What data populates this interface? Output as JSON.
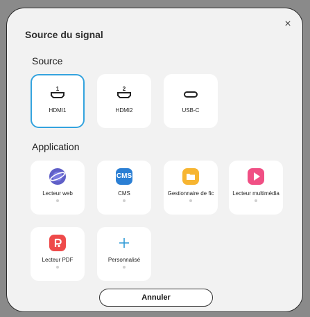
{
  "dialog": {
    "title": "Source du signal",
    "close_glyph": "×",
    "cancel_label": "Annuler"
  },
  "source": {
    "heading": "Source",
    "items": [
      {
        "label": "HDMI1",
        "port": "1",
        "icon": "hdmi-icon",
        "selected": true
      },
      {
        "label": "HDMI2",
        "port": "2",
        "icon": "hdmi-icon",
        "selected": false
      },
      {
        "label": "USB-C",
        "port": "",
        "icon": "usb-c-icon",
        "selected": false
      }
    ],
    "accent": "#33a3de"
  },
  "application": {
    "heading": "Application",
    "items": [
      {
        "label": "Lecteur web",
        "icon": "web-browser-icon",
        "color": "#5f5fc7"
      },
      {
        "label": "CMS",
        "icon": "cms-icon",
        "icon_text": "CMS",
        "color": "#2b7fd4"
      },
      {
        "label": "Gestionnaire de fic",
        "icon": "folder-icon",
        "color": "#f7b531"
      },
      {
        "label": "Lecteur multimédia",
        "icon": "media-player-icon",
        "color": "#f04f84"
      },
      {
        "label": "Lecteur PDF",
        "icon": "pdf-icon",
        "color": "#ee4a4a"
      },
      {
        "label": "Personnalisé",
        "icon": "plus-icon",
        "color": "#2f9ad6"
      }
    ]
  }
}
